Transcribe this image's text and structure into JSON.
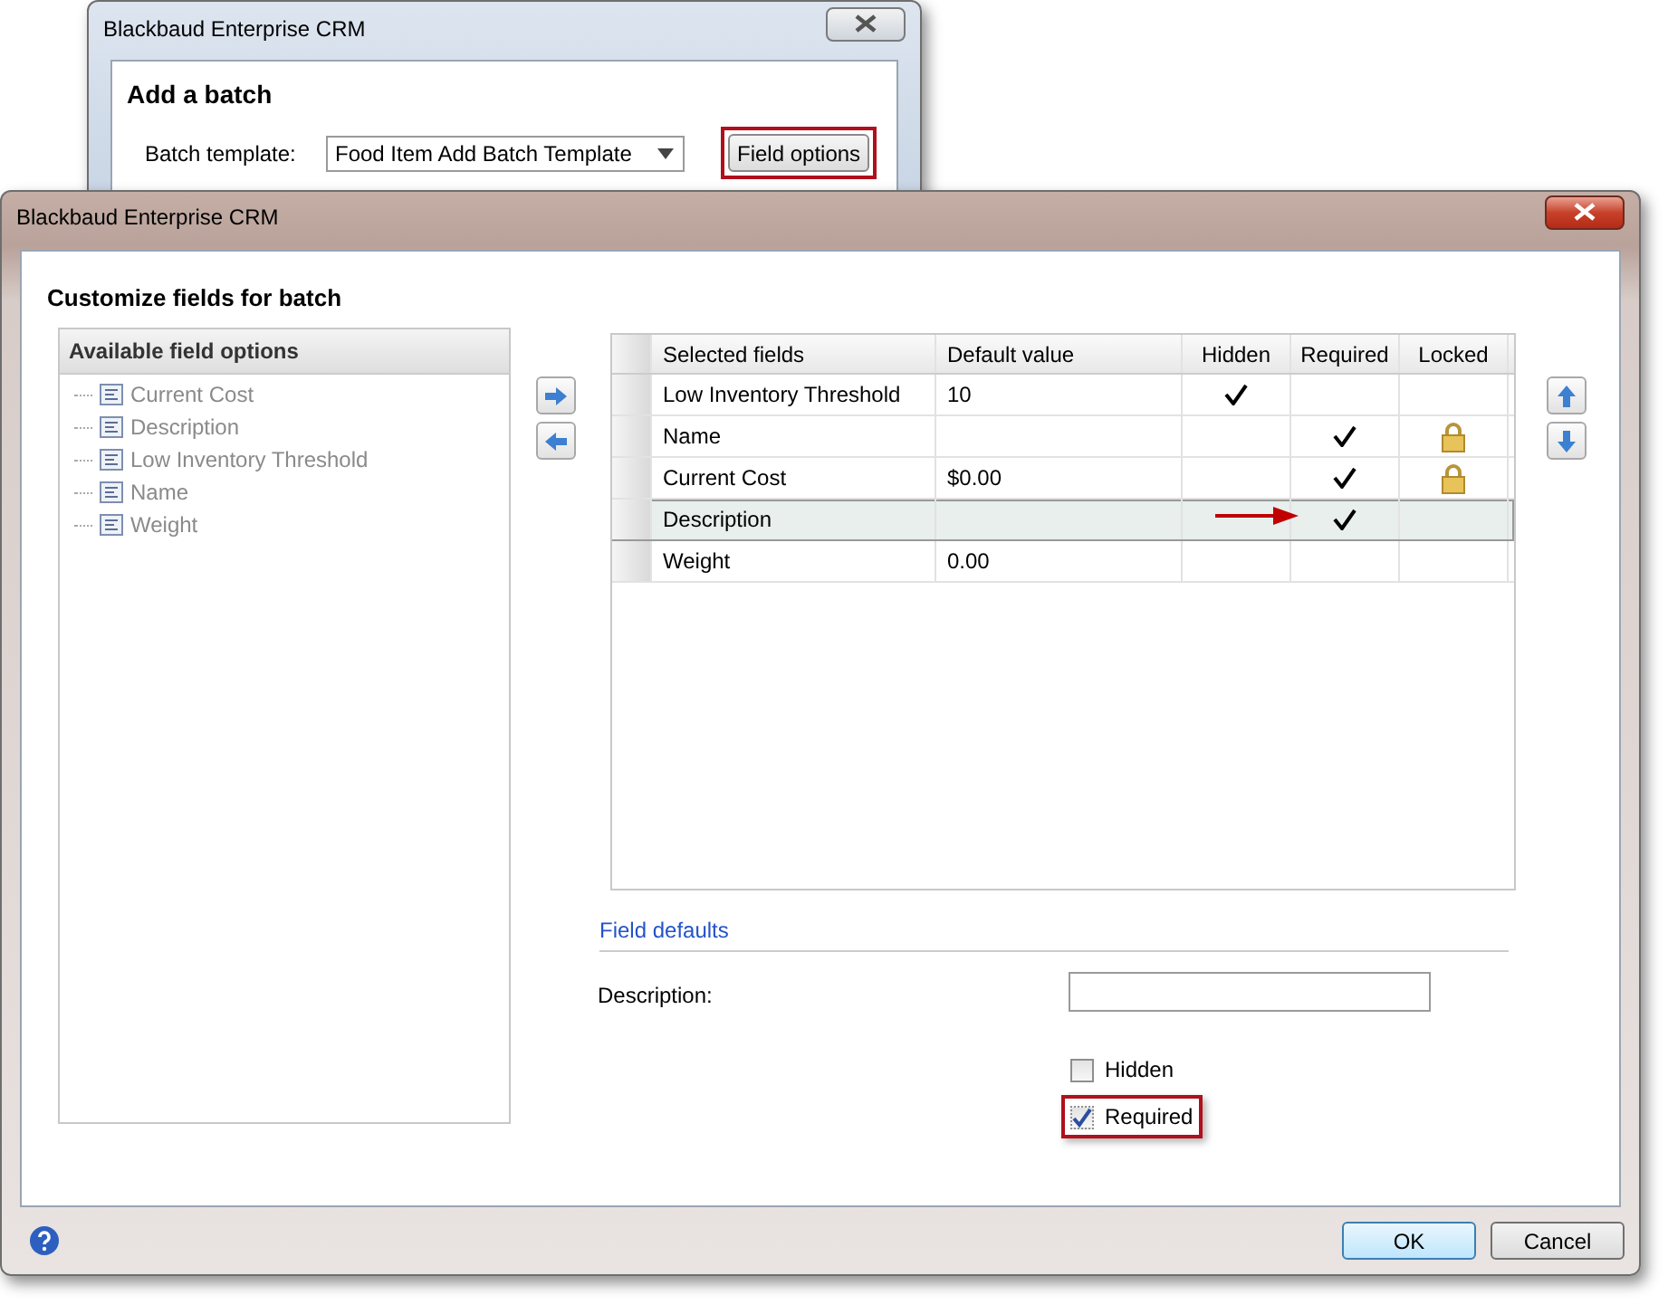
{
  "back_window": {
    "title": "Blackbaud Enterprise CRM",
    "heading": "Add a batch",
    "template_label": "Batch template:",
    "template_value": "Food Item Add Batch Template",
    "field_options_button": "Field options"
  },
  "window": {
    "title": "Blackbaud Enterprise CRM",
    "heading": "Customize fields for batch"
  },
  "available": {
    "title": "Available field options",
    "items": [
      {
        "label": "Current Cost"
      },
      {
        "label": "Description"
      },
      {
        "label": "Low Inventory Threshold"
      },
      {
        "label": "Name"
      },
      {
        "label": "Weight"
      }
    ]
  },
  "grid": {
    "columns": [
      "Selected fields",
      "Default value",
      "Hidden",
      "Required",
      "Locked"
    ],
    "rows": [
      {
        "field": "Low Inventory Threshold",
        "default": "10",
        "hidden": true,
        "required": false,
        "locked": false,
        "selected": false
      },
      {
        "field": "Name",
        "default": "",
        "hidden": false,
        "required": true,
        "locked": true,
        "selected": false
      },
      {
        "field": "Current Cost",
        "default": "$0.00",
        "hidden": false,
        "required": true,
        "locked": true,
        "selected": false
      },
      {
        "field": "Description",
        "default": "",
        "hidden": false,
        "required": true,
        "locked": false,
        "selected": true
      },
      {
        "field": "Weight",
        "default": "0.00",
        "hidden": false,
        "required": false,
        "locked": false,
        "selected": false
      }
    ]
  },
  "field_defaults": {
    "title": "Field defaults",
    "description_label": "Description:",
    "checkboxes": [
      {
        "label": "Hidden",
        "checked": false
      },
      {
        "label": "Required",
        "checked": true
      }
    ]
  },
  "buttons": [
    "OK",
    "Cancel"
  ]
}
